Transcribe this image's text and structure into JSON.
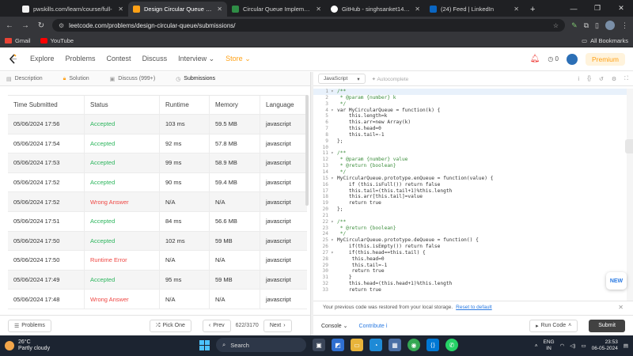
{
  "browser": {
    "tabs": [
      {
        "title": "pwskills.com/learn/course/full-",
        "color": "#f2f2f2",
        "active": false
      },
      {
        "title": "Design Circular Queue - LeetC",
        "color": "#ffa116",
        "active": true
      },
      {
        "title": "Circular Queue Implementation",
        "color": "#2f8d46",
        "active": false
      },
      {
        "title": "GitHub - singhsanket143/Data",
        "color": "#ffffff",
        "active": false
      },
      {
        "title": "(24) Feed | LinkedIn",
        "color": "#0a66c2",
        "active": false
      }
    ],
    "new_tab": "+",
    "url": "leetcode.com/problems/design-circular-queue/submissions/",
    "bookmarks": [
      {
        "label": "Gmail",
        "color": "#ea4335"
      },
      {
        "label": "YouTube",
        "color": "#ff0000"
      }
    ],
    "all_bookmarks": "All Bookmarks"
  },
  "lc_header": {
    "nav": [
      "Explore",
      "Problems",
      "Contest",
      "Discuss",
      "Interview",
      "Store"
    ],
    "notif_count": "0",
    "premium": "Premium"
  },
  "left_tabs": [
    {
      "label": "Description",
      "icon": "document-icon"
    },
    {
      "label": "Solution",
      "icon": "lock-icon"
    },
    {
      "label": "Discuss (999+)",
      "icon": "chat-icon"
    },
    {
      "label": "Submissions",
      "icon": "clock-icon"
    }
  ],
  "table": {
    "headers": [
      "Time Submitted",
      "Status",
      "Runtime",
      "Memory",
      "Language"
    ],
    "rows": [
      {
        "time": "05/06/2024 17:56",
        "status": "Accepted",
        "ok": true,
        "runtime": "103 ms",
        "memory": "59.5 MB",
        "lang": "javascript"
      },
      {
        "time": "05/06/2024 17:54",
        "status": "Accepted",
        "ok": true,
        "runtime": "92 ms",
        "memory": "57.8 MB",
        "lang": "javascript"
      },
      {
        "time": "05/06/2024 17:53",
        "status": "Accepted",
        "ok": true,
        "runtime": "99 ms",
        "memory": "58.9 MB",
        "lang": "javascript"
      },
      {
        "time": "05/06/2024 17:52",
        "status": "Accepted",
        "ok": true,
        "runtime": "90 ms",
        "memory": "59.4 MB",
        "lang": "javascript"
      },
      {
        "time": "05/06/2024 17:52",
        "status": "Wrong Answer",
        "ok": false,
        "runtime": "N/A",
        "memory": "N/A",
        "lang": "javascript"
      },
      {
        "time": "05/06/2024 17:51",
        "status": "Accepted",
        "ok": true,
        "runtime": "84 ms",
        "memory": "56.6 MB",
        "lang": "javascript"
      },
      {
        "time": "05/06/2024 17:50",
        "status": "Accepted",
        "ok": true,
        "runtime": "102 ms",
        "memory": "59 MB",
        "lang": "javascript"
      },
      {
        "time": "05/06/2024 17:50",
        "status": "Runtime Error",
        "ok": false,
        "runtime": "N/A",
        "memory": "N/A",
        "lang": "javascript"
      },
      {
        "time": "05/06/2024 17:49",
        "status": "Accepted",
        "ok": true,
        "runtime": "95 ms",
        "memory": "59 MB",
        "lang": "javascript"
      },
      {
        "time": "05/06/2024 17:48",
        "status": "Wrong Answer",
        "ok": false,
        "runtime": "N/A",
        "memory": "N/A",
        "lang": "javascript"
      }
    ]
  },
  "left_footer": {
    "problems": "Problems",
    "pick_one": "Pick One",
    "prev": "Prev",
    "page": "622/3170",
    "next": "Next"
  },
  "editor": {
    "language": "JavaScript",
    "autocomplete": "Autocomplete",
    "lines": [
      "/**",
      " * @param {number} k",
      " */",
      "var MyCircularQueue = function(k) {",
      "    this.length=k",
      "    this.arr=new Array(k)",
      "    this.head=0",
      "    this.tail=-1",
      "};",
      "",
      "/**",
      " * @param {number} value",
      " * @return {boolean}",
      " */",
      "MyCircularQueue.prototype.enQueue = function(value) {",
      "    if (this.isFull()) return false",
      "    this.tail=(this.tail+1)%this.length",
      "    this.arr[this.tail]=value",
      "    return true",
      "};",
      "",
      "/**",
      " * @return {boolean}",
      " */",
      "MyCircularQueue.prototype.deQueue = function() {",
      "    if(this.isEmpty()) return false",
      "    if(this.head==this.tail) {",
      "     this.head=0",
      "     this.tail=-1",
      "     return true",
      "    }",
      "    this.head=(this.head+1)%this.length",
      "    return true"
    ],
    "fold_lines": [
      1,
      4,
      11,
      15,
      22,
      25,
      27
    ],
    "restore_msg": "Your previous code was restored from your local storage.",
    "restore_link": "Reset to default",
    "console": "Console",
    "contribute": "Contribute",
    "run": "Run Code",
    "submit": "Submit",
    "new_badge": "NEW"
  },
  "taskbar": {
    "temp": "26°C",
    "weather": "Partly cloudy",
    "search": "Search",
    "lang1": "ENG",
    "lang2": "IN",
    "time": "23:53",
    "date": "06-05-2024"
  },
  "colors": {
    "accent": "#ffa116",
    "ok": "#2db55d",
    "err": "#ef4743"
  }
}
